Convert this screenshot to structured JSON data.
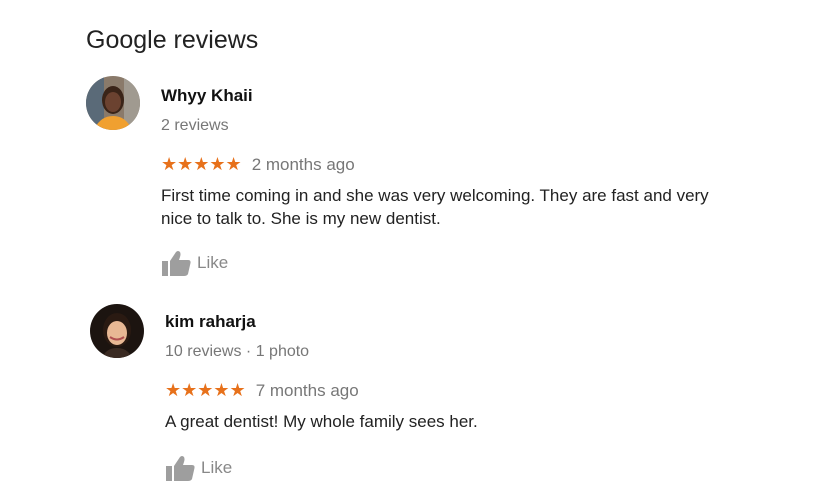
{
  "header": {
    "title": "Google reviews"
  },
  "reviews": [
    {
      "author": "Whyy Khaii",
      "meta": "2 reviews",
      "stars": "★★★★★",
      "rating": 5,
      "time": "2 months ago",
      "text": "First time coming in and she was very welcoming. They are fast and very nice to talk to. She is my new dentist.",
      "like_label": "Like"
    },
    {
      "author": "kim raharja",
      "meta": "10 reviews · 1 photo",
      "stars": "★★★★★",
      "rating": 5,
      "time": "7 months ago",
      "text": "A great dentist! My whole family sees her.",
      "like_label": "Like"
    }
  ],
  "colors": {
    "star": "#e7711b",
    "muted_text": "#777777",
    "like_icon": "#9e9e9e"
  },
  "icons": {
    "like": "thumbs-up-icon"
  }
}
